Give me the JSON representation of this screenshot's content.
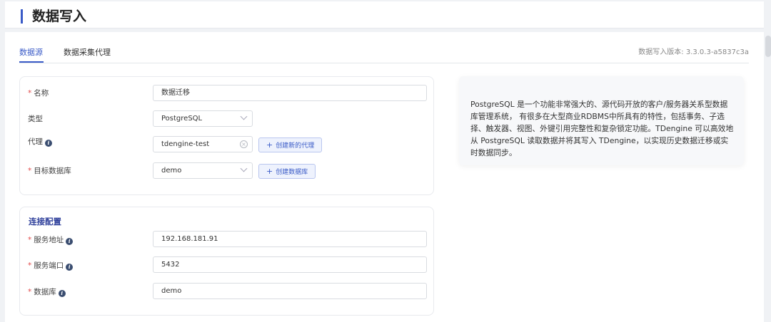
{
  "header": {
    "title": "数据写入"
  },
  "tabs": [
    {
      "label": "数据源",
      "active": true
    },
    {
      "label": "数据采集代理",
      "active": false
    }
  ],
  "version": "数据写入版本: 3.3.0.3-a5837c3a",
  "basic": {
    "name": {
      "label": "名称",
      "value": "数据迁移"
    },
    "type": {
      "label": "类型",
      "value": "PostgreSQL"
    },
    "agent": {
      "label": "代理",
      "value": "tdengine-test",
      "button": "创建新的代理"
    },
    "target_db": {
      "label": "目标数据库",
      "value": "demo",
      "button": "创建数据库"
    }
  },
  "connection": {
    "title": "连接配置",
    "host": {
      "label": "服务地址",
      "value": "192.168.181.91"
    },
    "port": {
      "label": "服务端口",
      "value": "5432"
    },
    "database": {
      "label": "数据库",
      "value": "demo"
    }
  },
  "description": "PostgreSQL 是一个功能非常强大的、源代码开放的客户/服务器关系型数据库管理系统， 有很多在大型商业RDBMS中所具有的特性，包括事务、子选择、触发器、视图、外键引用完整性和复杂锁定功能。TDengine 可以高效地从 PostgreSQL 读取数据并将其写入 TDengine，以实现历史数据迁移或实时数据同步。",
  "icons": {
    "info": "info-icon",
    "dropdown": "chevron-down-icon",
    "clear": "clear-icon",
    "add": "plus-icon"
  },
  "colors": {
    "accent": "#3a5bc7",
    "required": "#e34d4d"
  }
}
